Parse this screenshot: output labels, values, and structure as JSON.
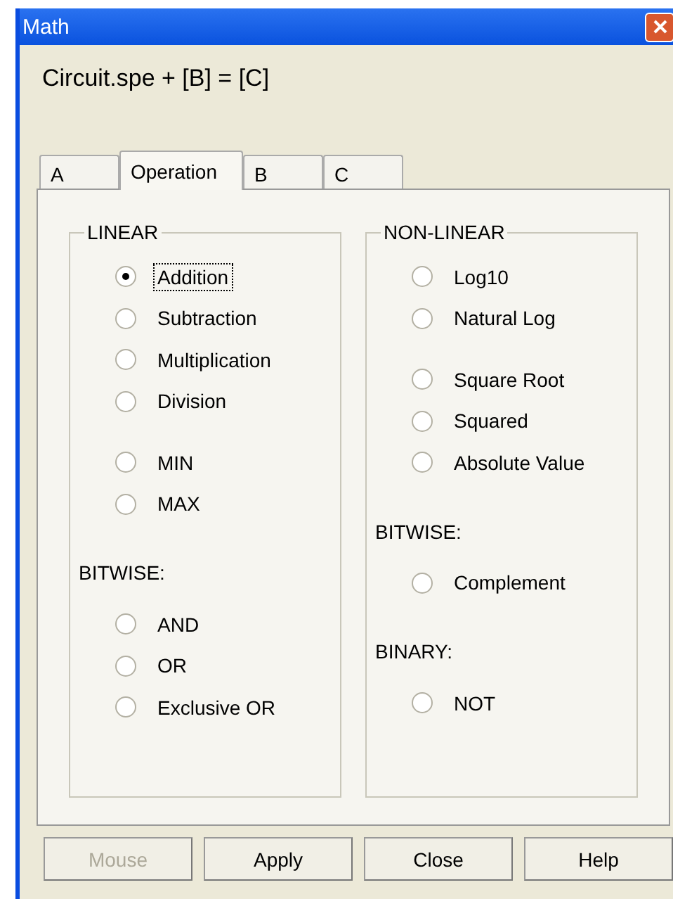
{
  "window": {
    "title": "Math"
  },
  "heading": "Circuit.spe + [B] = [C]",
  "tabs": [
    {
      "label": "A",
      "selected": false
    },
    {
      "label": "Operation",
      "selected": true
    },
    {
      "label": "B",
      "selected": false
    },
    {
      "label": "C",
      "selected": false
    }
  ],
  "groups": [
    {
      "title": "LINEAR",
      "sections": [
        {
          "options": [
            {
              "label": "Addition",
              "selected": true
            },
            {
              "label": "Subtraction",
              "selected": false
            },
            {
              "label": "Multiplication",
              "selected": false
            },
            {
              "label": "Division",
              "selected": false
            }
          ]
        },
        {
          "options": [
            {
              "label": "MIN",
              "selected": false
            },
            {
              "label": "MAX",
              "selected": false
            }
          ]
        },
        {
          "heading": "BITWISE:",
          "options": [
            {
              "label": "AND",
              "selected": false
            },
            {
              "label": "OR",
              "selected": false
            },
            {
              "label": "Exclusive OR",
              "selected": false
            }
          ]
        }
      ]
    },
    {
      "title": "NON-LINEAR",
      "sections": [
        {
          "options": [
            {
              "label": "Log10",
              "selected": false
            },
            {
              "label": "Natural Log",
              "selected": false
            }
          ]
        },
        {
          "options": [
            {
              "label": "Square Root",
              "selected": false
            },
            {
              "label": "Squared",
              "selected": false
            },
            {
              "label": "Absolute Value",
              "selected": false
            }
          ]
        },
        {
          "heading": "BITWISE:",
          "options": [
            {
              "label": "Complement",
              "selected": false
            }
          ]
        },
        {
          "heading": "BINARY:",
          "options": [
            {
              "label": "NOT",
              "selected": false
            }
          ]
        }
      ]
    }
  ],
  "buttons": [
    {
      "label": "Mouse",
      "disabled": true
    },
    {
      "label": "Apply",
      "disabled": false
    },
    {
      "label": "Close",
      "disabled": false
    },
    {
      "label": "Help",
      "disabled": false
    }
  ]
}
